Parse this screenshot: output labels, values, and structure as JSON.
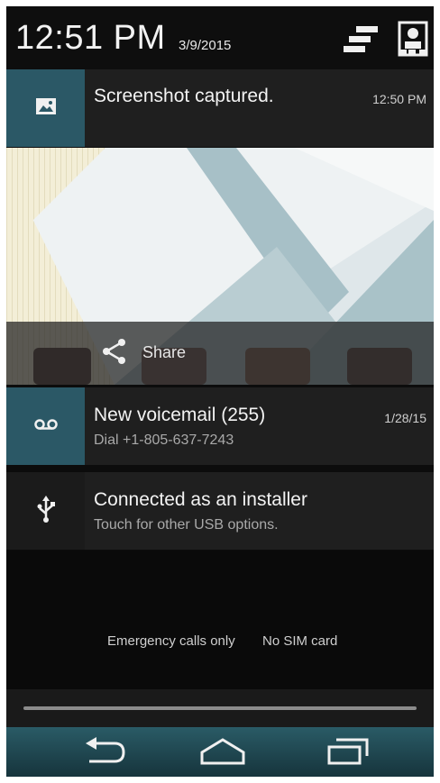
{
  "status_bar": {
    "time": "12:51 PM",
    "date": "3/9/2015",
    "icons": [
      "quick-settings-toggle-icon",
      "user-profile-icon"
    ]
  },
  "notifications": [
    {
      "icon": "image-icon",
      "title": "Screenshot captured.",
      "time": "12:50 PM",
      "action_label": "Share",
      "action_icon": "share-icon"
    },
    {
      "icon": "voicemail-icon",
      "title": "New voicemail (255)",
      "subtitle": "Dial +1-805-637-7243",
      "time": "1/28/15"
    },
    {
      "icon": "usb-icon",
      "title": "Connected as an installer",
      "subtitle": "Touch for other USB options."
    }
  ],
  "carrier": {
    "emergency": "Emergency calls only",
    "sim": "No SIM card"
  },
  "nav": [
    "back-icon",
    "home-icon",
    "recents-icon"
  ],
  "colors": {
    "accent": "#2b5866",
    "notification_bg": "#1f1f1f",
    "panel_bg": "#0c0c0c"
  }
}
